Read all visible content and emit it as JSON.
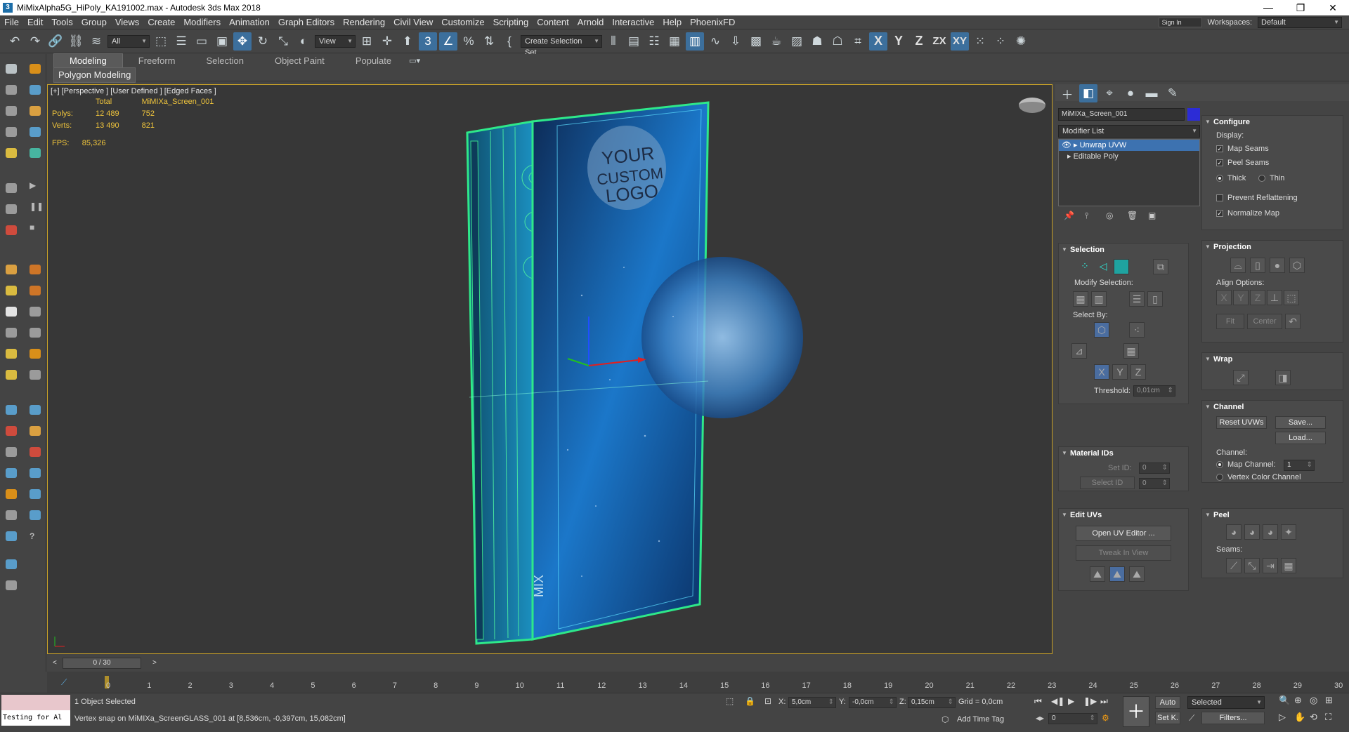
{
  "window": {
    "title": "MiMixAlpha5G_HiPoly_KA191002.max - Autodesk 3ds Max 2018"
  },
  "menu": [
    "File",
    "Edit",
    "Tools",
    "Group",
    "Views",
    "Create",
    "Modifiers",
    "Animation",
    "Graph Editors",
    "Rendering",
    "Civil View",
    "Customize",
    "Scripting",
    "Content",
    "Arnold",
    "Interactive",
    "Help",
    "PhoenixFD"
  ],
  "menu_right": {
    "signin": "Sign In",
    "workspaces_label": "Workspaces:",
    "workspace": "Default"
  },
  "toolbar": {
    "filter": "All",
    "ref_coord": "View",
    "selection_set": "Create Selection Set",
    "axis_x": "X",
    "axis_y": "Y",
    "axis_z": "Z",
    "axis_zx": "ZX",
    "axis_xy": "XY"
  },
  "ribbon": {
    "tabs": [
      "Modeling",
      "Freeform",
      "Selection",
      "Object Paint",
      "Populate"
    ],
    "sub": "Polygon Modeling"
  },
  "viewport": {
    "label": "[+] [Perspective ] [User Defined ] [Edged Faces ]",
    "stats": {
      "total": "Total",
      "object": "MiMIXa_Screen_001",
      "polys_label": "Polys:",
      "polys_total": "12 489",
      "polys_obj": "752",
      "verts_label": "Verts:",
      "verts_total": "13 490",
      "verts_obj": "821"
    },
    "fps_label": "FPS:",
    "fps": "85,326",
    "logo": [
      "YOUR",
      "CUSTOM",
      "LOGO"
    ],
    "phone_text": "MIX"
  },
  "command_panel": {
    "object_name": "MiMIXa_Screen_001",
    "object_color": "#2c2cd6",
    "modifier_list": "Modifier List",
    "stack": [
      "Unwrap UVW",
      "Editable Poly"
    ],
    "selection": {
      "title": "Selection",
      "modify": "Modify Selection:",
      "select_by": "Select By:",
      "threshold_label": "Threshold:",
      "threshold": "0,01cm"
    },
    "material_ids": {
      "title": "Material IDs",
      "set_id": "Set ID:",
      "set_id_val": "0",
      "select_id": "Select ID",
      "select_id_val": "0"
    },
    "edit_uvs": {
      "title": "Edit UVs",
      "open": "Open UV Editor ...",
      "tweak": "Tweak In View"
    },
    "configure": {
      "title": "Configure",
      "display": "Display:",
      "map_seams": "Map Seams",
      "peel_seams": "Peel Seams",
      "thick": "Thick",
      "thin": "Thin",
      "prevent": "Prevent Reflattening",
      "normalize": "Normalize Map"
    },
    "projection": {
      "title": "Projection",
      "align": "Align Options:",
      "x": "X",
      "y": "Y",
      "z": "Z",
      "fit": "Fit",
      "center": "Center"
    },
    "wrap": {
      "title": "Wrap"
    },
    "channel": {
      "title": "Channel",
      "reset": "Reset UVWs",
      "save": "Save...",
      "load": "Load...",
      "channel_label": "Channel:",
      "map_channel": "Map Channel:",
      "map_channel_val": "1",
      "vertex_color": "Vertex Color Channel"
    },
    "peel": {
      "title": "Peel",
      "seams": "Seams:"
    }
  },
  "timeline": {
    "frame": "0 / 30",
    "ticks": [
      "0",
      "1",
      "2",
      "3",
      "4",
      "5",
      "6",
      "7",
      "8",
      "9",
      "10",
      "11",
      "12",
      "13",
      "14",
      "15",
      "16",
      "17",
      "18",
      "19",
      "20",
      "21",
      "22",
      "23",
      "24",
      "25",
      "26",
      "27",
      "28",
      "29",
      "30"
    ]
  },
  "status": {
    "selected": "1 Object Selected",
    "prompt": "Vertex snap on MiMIXa_ScreenGLASS_001 at [8,536cm, -0,397cm, 15,082cm]",
    "script": "Testing for Al",
    "x_label": "X:",
    "x": "5,0cm",
    "y_label": "Y:",
    "y": "-0,0cm",
    "z_label": "Z:",
    "z": "0,15cm",
    "grid": "Grid = 0,0cm",
    "add_time_tag": "Add Time Tag",
    "auto": "Auto",
    "set_key": "Set K.",
    "selected_dd": "Selected",
    "filters": "Filters...",
    "frame_val": "0"
  }
}
